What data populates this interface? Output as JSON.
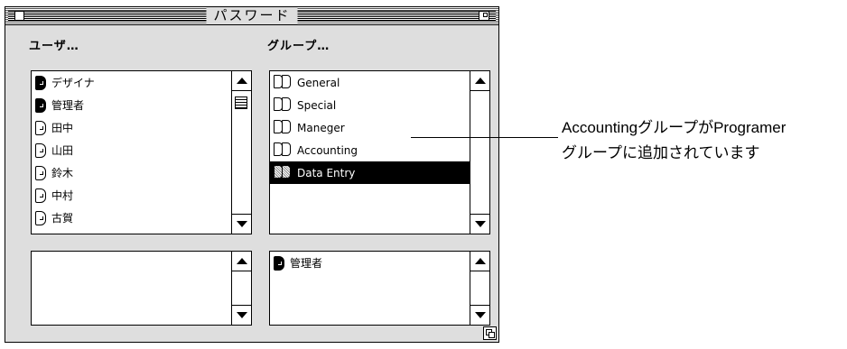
{
  "window": {
    "title": "パスワード"
  },
  "users": {
    "label": "ユーザ…",
    "items": [
      {
        "name": "デザイナ",
        "filled": true
      },
      {
        "name": "管理者",
        "filled": true
      },
      {
        "name": "田中",
        "filled": false
      },
      {
        "name": "山田",
        "filled": false
      },
      {
        "name": "鈴木",
        "filled": false
      },
      {
        "name": "中村",
        "filled": false
      },
      {
        "name": "古賀",
        "filled": false
      }
    ]
  },
  "groups": {
    "label": "グループ…",
    "items": [
      {
        "name": "General",
        "selected": false
      },
      {
        "name": "Special",
        "selected": false
      },
      {
        "name": "Maneger",
        "selected": false
      },
      {
        "name": "Accounting",
        "selected": false
      },
      {
        "name": "Data Entry",
        "selected": true
      }
    ]
  },
  "members": {
    "items": [
      {
        "name": "管理者",
        "filled": true
      }
    ]
  },
  "annotation": {
    "line1": "AccountingグループがProgramer",
    "line2": "グループに追加されています"
  }
}
